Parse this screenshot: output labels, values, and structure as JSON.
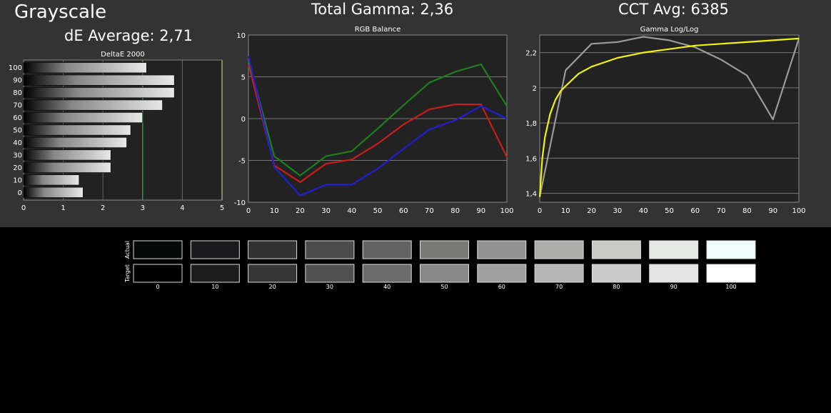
{
  "header": {
    "title": "Grayscale",
    "total_gamma": "Total Gamma: 2,36",
    "cct_avg": "CCT Avg: 6385",
    "de_average": "dE Average: 2,71"
  },
  "chart_data": [
    {
      "type": "bar",
      "title": "DeltaE 2000",
      "orientation": "horizontal",
      "categories": [
        "100",
        "90",
        "80",
        "70",
        "60",
        "50",
        "40",
        "30",
        "20",
        "10",
        "0"
      ],
      "values": [
        3.1,
        3.8,
        3.8,
        3.5,
        3.0,
        2.7,
        2.6,
        2.2,
        2.2,
        1.4,
        1.5
      ],
      "xlim": [
        0,
        5
      ],
      "xticks": [
        "0",
        "1",
        "2",
        "3",
        "4",
        "5"
      ],
      "reference_lines": [
        {
          "value": 3,
          "color": "#2f9a2f"
        },
        {
          "value": 5,
          "color": "#d8d83a"
        }
      ],
      "grid": true
    },
    {
      "type": "line",
      "title": "RGB Balance",
      "x": [
        0,
        10,
        20,
        30,
        40,
        50,
        60,
        70,
        80,
        90,
        100
      ],
      "xticks": [
        "0",
        "10",
        "20",
        "30",
        "40",
        "50",
        "60",
        "70",
        "80",
        "90",
        "100"
      ],
      "yticks": [
        "10",
        "5",
        "0",
        "-5",
        "-10"
      ],
      "ylim": [
        -10,
        10
      ],
      "series": [
        {
          "color": "#cc1b1b",
          "values": [
            6.5,
            -5.6,
            -7.6,
            -5.4,
            -4.9,
            -3.0,
            -0.7,
            1.1,
            1.7,
            1.7,
            -4.6
          ]
        },
        {
          "color": "#1e7f1e",
          "values": [
            7.0,
            -4.5,
            -6.8,
            -4.5,
            -3.9,
            -1.2,
            1.6,
            4.3,
            5.6,
            6.5,
            1.5
          ]
        },
        {
          "color": "#1f1fd6",
          "values": [
            7.5,
            -5.8,
            -9.2,
            -7.9,
            -7.9,
            -6.0,
            -3.6,
            -1.3,
            -0.2,
            1.5,
            0.0
          ]
        }
      ],
      "grid": true
    },
    {
      "type": "line",
      "title": "Gamma Log/Log",
      "xticks": [
        "0",
        "10",
        "20",
        "30",
        "40",
        "50",
        "60",
        "70",
        "80",
        "90",
        "100"
      ],
      "yticks": [
        "2,2",
        "2",
        "1,8",
        "1,6",
        "1,4"
      ],
      "ylim": [
        1.35,
        2.3
      ],
      "series": [
        {
          "color": "#9a9a9a",
          "x": [
            0,
            10,
            20,
            30,
            40,
            50,
            60,
            70,
            80,
            90,
            100
          ],
          "values": [
            1.38,
            2.1,
            2.25,
            2.26,
            2.29,
            2.27,
            2.23,
            2.16,
            2.07,
            1.82,
            2.28
          ]
        },
        {
          "color": "#f2f20a",
          "x": [
            0,
            1,
            2,
            4,
            6,
            8,
            10,
            15,
            20,
            30,
            40,
            50,
            60,
            70,
            80,
            90,
            100
          ],
          "values": [
            1.38,
            1.6,
            1.72,
            1.85,
            1.93,
            1.98,
            2.01,
            2.08,
            2.12,
            2.17,
            2.2,
            2.22,
            2.24,
            2.25,
            2.26,
            2.27,
            2.28
          ]
        }
      ],
      "grid": true
    }
  ],
  "swatches": {
    "row_labels": [
      "Actual",
      "Target"
    ],
    "labels": [
      "0",
      "10",
      "20",
      "30",
      "40",
      "50",
      "60",
      "70",
      "80",
      "90",
      "100"
    ],
    "actual_colors": [
      "#050807",
      "#1b1b1d",
      "#323233",
      "#4b4b4b",
      "#626262",
      "#7a7a79",
      "#929292",
      "#ababaa",
      "#c9cac6",
      "#e7e9e6",
      "#f2fdff"
    ],
    "target_colors": [
      "#000000",
      "#1d1d1d",
      "#363636",
      "#505050",
      "#6b6b6b",
      "#878787",
      "#a0a0a0",
      "#b5b5b5",
      "#cbcbcb",
      "#e4e4e4",
      "#ffffff"
    ]
  }
}
